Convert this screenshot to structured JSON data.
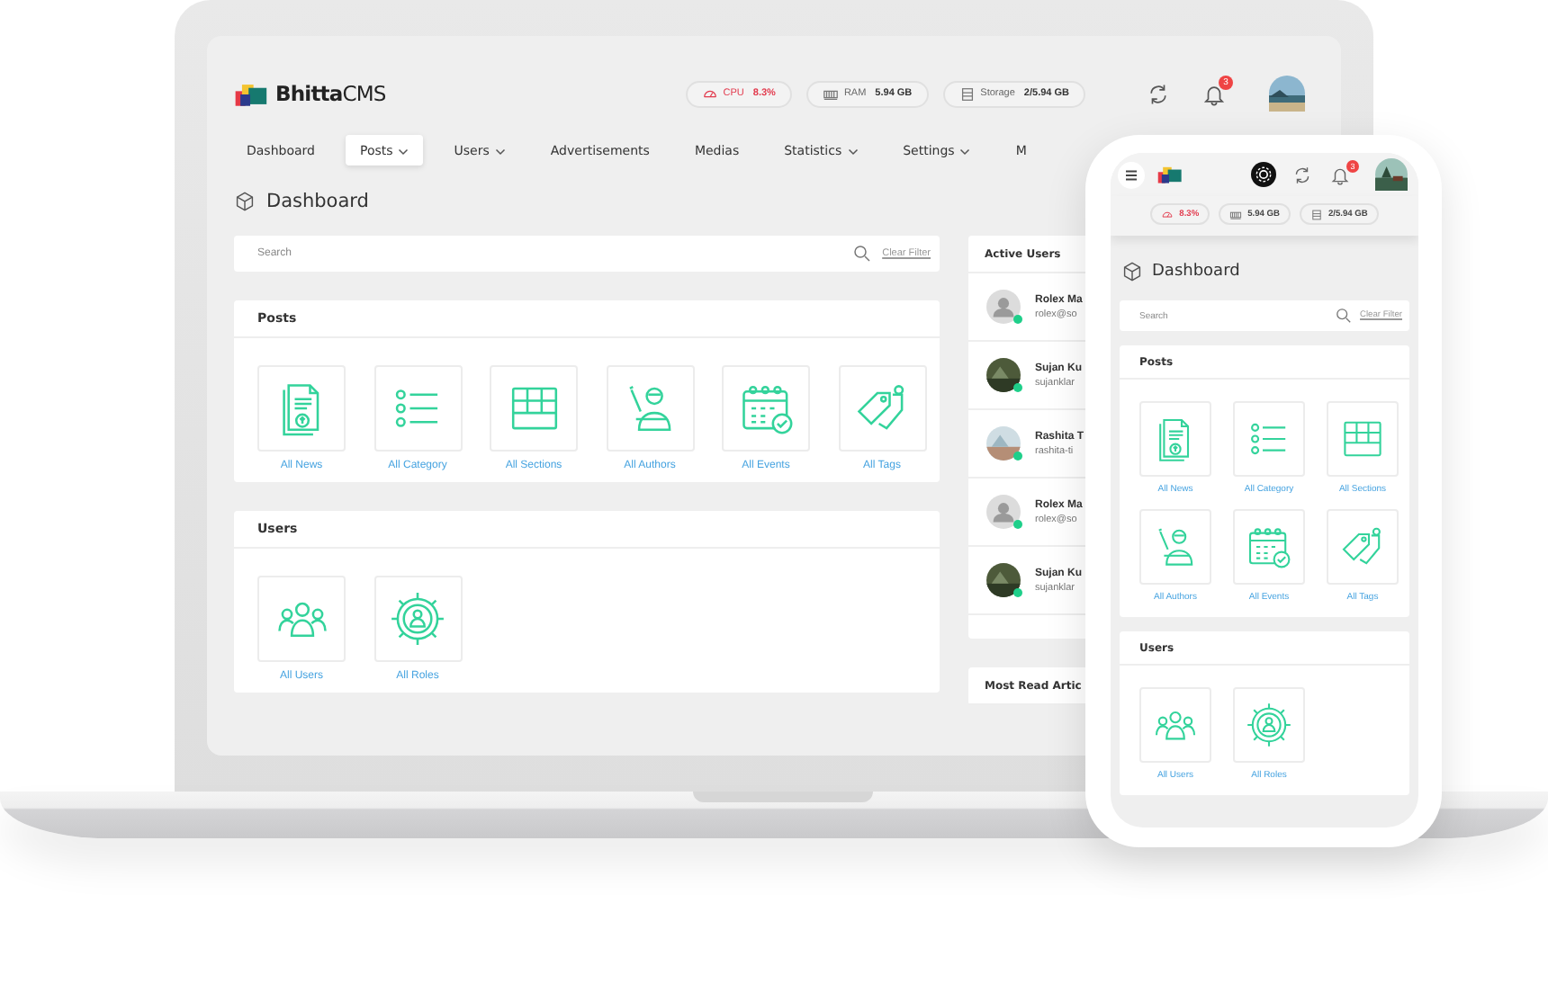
{
  "laptop": {
    "brand": {
      "name": "Bhitta",
      "suffix": "CMS"
    },
    "stats": [
      {
        "kind": "cpu",
        "label": "CPU",
        "value": "8.3%"
      },
      {
        "kind": "ram",
        "label": "RAM",
        "value": "5.94 GB"
      },
      {
        "kind": "storage",
        "label": "Storage",
        "value": "2/5.94 GB"
      }
    ],
    "notifications": "3",
    "nav": [
      {
        "label": "Dashboard",
        "selected": false,
        "dropdown": false
      },
      {
        "label": "Posts",
        "selected": true,
        "dropdown": true
      },
      {
        "label": "Users",
        "selected": false,
        "dropdown": true
      },
      {
        "label": "Advertisements",
        "selected": false,
        "dropdown": false
      },
      {
        "label": "Medias",
        "selected": false,
        "dropdown": false
      },
      {
        "label": "Statistics",
        "selected": false,
        "dropdown": true
      },
      {
        "label": "Settings",
        "selected": false,
        "dropdown": true
      },
      {
        "label": "M",
        "selected": false,
        "dropdown": false
      }
    ],
    "page_title": "Dashboard",
    "search": {
      "placeholder": "Search",
      "clear": "Clear Filter"
    },
    "sections": [
      {
        "title": "Posts",
        "items": [
          {
            "kind": "news",
            "label": "All News"
          },
          {
            "kind": "category",
            "label": "All Category"
          },
          {
            "kind": "sections",
            "label": "All Sections"
          },
          {
            "kind": "authors",
            "label": "All Authors"
          },
          {
            "kind": "events",
            "label": "All Events"
          },
          {
            "kind": "tags",
            "label": "All Tags"
          }
        ]
      },
      {
        "title": "Users",
        "items": [
          {
            "kind": "users",
            "label": "All Users"
          },
          {
            "kind": "roles",
            "label": "All Roles"
          }
        ]
      }
    ],
    "active_users": {
      "title": "Active Users",
      "users": [
        {
          "name": "Rolex Ma",
          "email": "rolex@so",
          "kind": "default"
        },
        {
          "name": "Sujan Ku",
          "email": "sujanklar"
        },
        {
          "name": "Rashita T",
          "email": "rashita-ti"
        },
        {
          "name": "Rolex Ma",
          "email": "rolex@so",
          "kind": "default"
        },
        {
          "name": "Sujan Ku",
          "email": "sujanklar"
        }
      ]
    },
    "most_read": {
      "title": "Most Read Artic"
    }
  },
  "phone": {
    "notifications": "3",
    "stats": [
      {
        "kind": "cpu",
        "value": "8.3%"
      },
      {
        "kind": "ram",
        "value": "5.94 GB"
      },
      {
        "kind": "storage",
        "value": "2/5.94 GB"
      }
    ],
    "page_title": "Dashboard",
    "search": {
      "placeholder": "Search",
      "clear": "Clear Filter"
    },
    "sections": [
      {
        "title": "Posts",
        "items": [
          {
            "kind": "news",
            "label": "All News"
          },
          {
            "kind": "category",
            "label": "All Category"
          },
          {
            "kind": "sections",
            "label": "All Sections"
          },
          {
            "kind": "authors",
            "label": "All Authors"
          },
          {
            "kind": "events",
            "label": "All Events"
          },
          {
            "kind": "tags",
            "label": "All Tags"
          }
        ]
      },
      {
        "title": "Users",
        "items": [
          {
            "kind": "users",
            "label": "All Users"
          },
          {
            "kind": "roles",
            "label": "All Roles"
          }
        ]
      }
    ]
  }
}
